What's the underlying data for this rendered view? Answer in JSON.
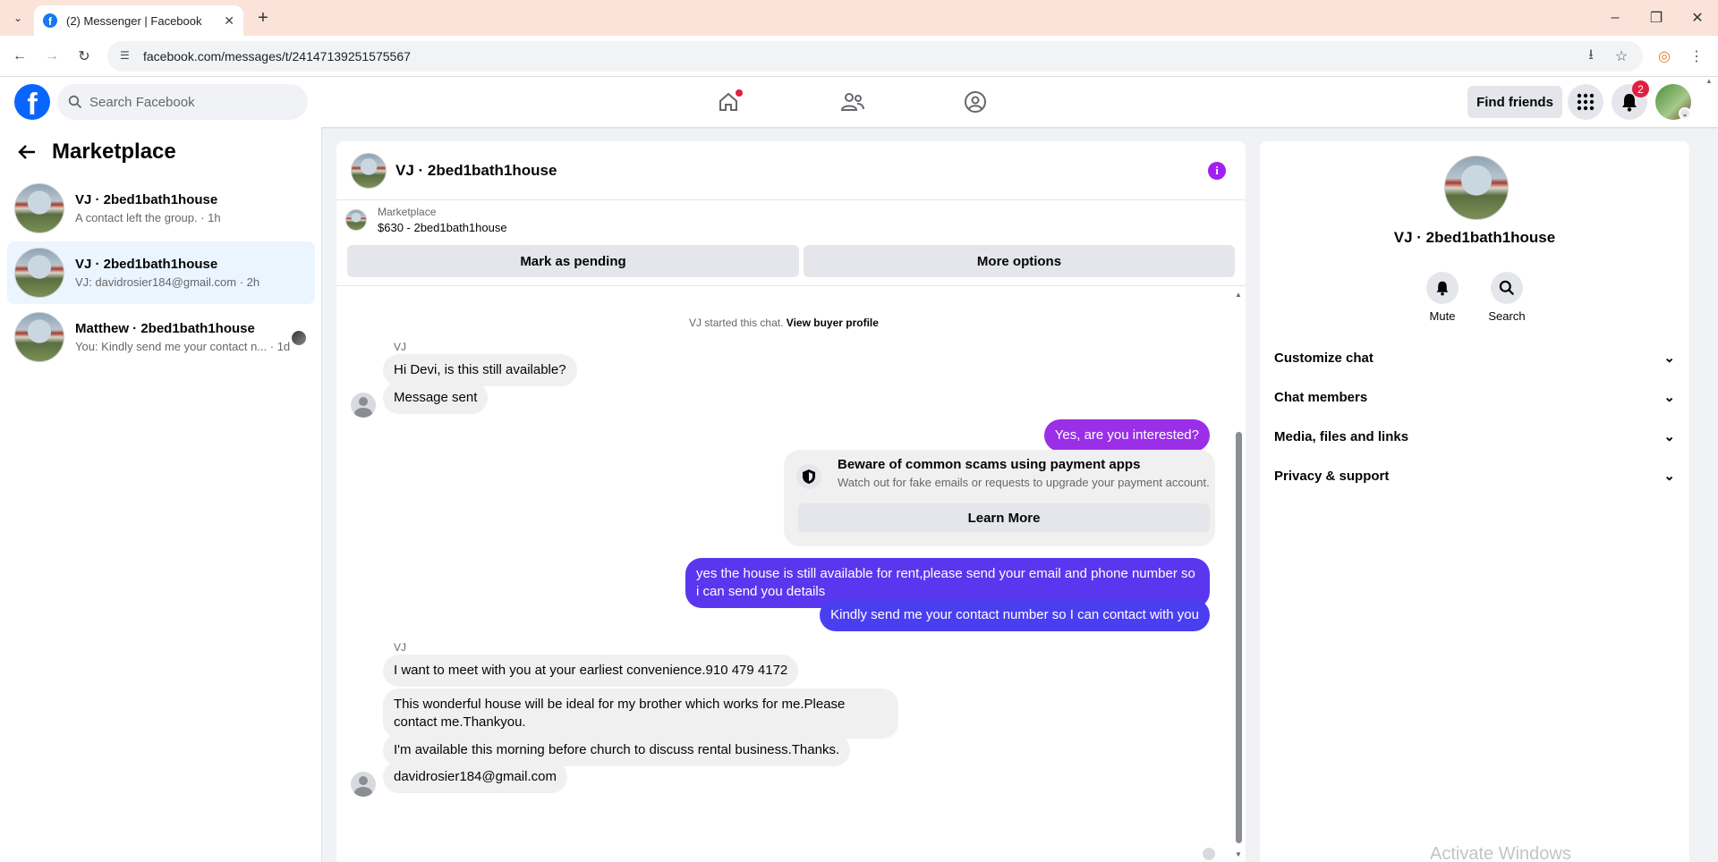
{
  "browser": {
    "tab_title": "(2) Messenger | Facebook",
    "url": "facebook.com/messages/t/24147139251575567"
  },
  "fbnav": {
    "search_placeholder": "Search Facebook",
    "find_friends": "Find friends",
    "notification_count": "2",
    "accent": "#0866ff"
  },
  "left": {
    "title": "Marketplace",
    "conversations": [
      {
        "name": "VJ · 2bed1bath1house",
        "preview": "A contact left the group. · 1h"
      },
      {
        "name": "VJ · 2bed1bath1house",
        "preview": "VJ: davidrosier184@gmail.com · 2h"
      },
      {
        "name": "Matthew · 2bed1bath1house",
        "preview": "You: Kindly send me your contact n... · 1d"
      }
    ]
  },
  "chat": {
    "title": "VJ · 2bed1bath1house",
    "listing_label": "Marketplace",
    "listing_price": "$630 - 2bed1bath1house",
    "mark_pending": "Mark as pending",
    "more_options": "More options",
    "system_prefix": "VJ started this chat.",
    "system_link": "View buyer profile",
    "sender_1": "VJ",
    "msg_in_1": "Hi Devi, is this still available?",
    "msg_in_2": "Message sent",
    "msg_out_1": "Yes, are you interested?",
    "scam_title": "Beware of common scams using payment apps",
    "scam_desc": "Watch out for fake emails or requests to upgrade your payment account.",
    "scam_button": "Learn More",
    "msg_out_2": "yes the house is still available for rent,please send your email and phone number so i can send you details",
    "msg_out_3": "Kindly send me your contact number so I can contact with you",
    "sender_2": "VJ",
    "msg_in_3": "I want to meet with you at your earliest convenience.910 479 4172",
    "msg_in_4": "This wonderful house will be ideal for my brother which works for me.Please contact me.Thankyou.",
    "msg_in_5": "I'm available this morning before church to discuss rental business.Thanks.",
    "msg_in_6": "davidrosier184@gmail.com",
    "outgoing_color_1": "#9b2fe8",
    "outgoing_color_2": "#4a3ff0"
  },
  "right": {
    "name": "VJ · 2bed1bath1house",
    "mute": "Mute",
    "search": "Search",
    "sections": [
      "Customize chat",
      "Chat members",
      "Media, files and links",
      "Privacy & support"
    ],
    "watermark": "Activate Windows"
  }
}
